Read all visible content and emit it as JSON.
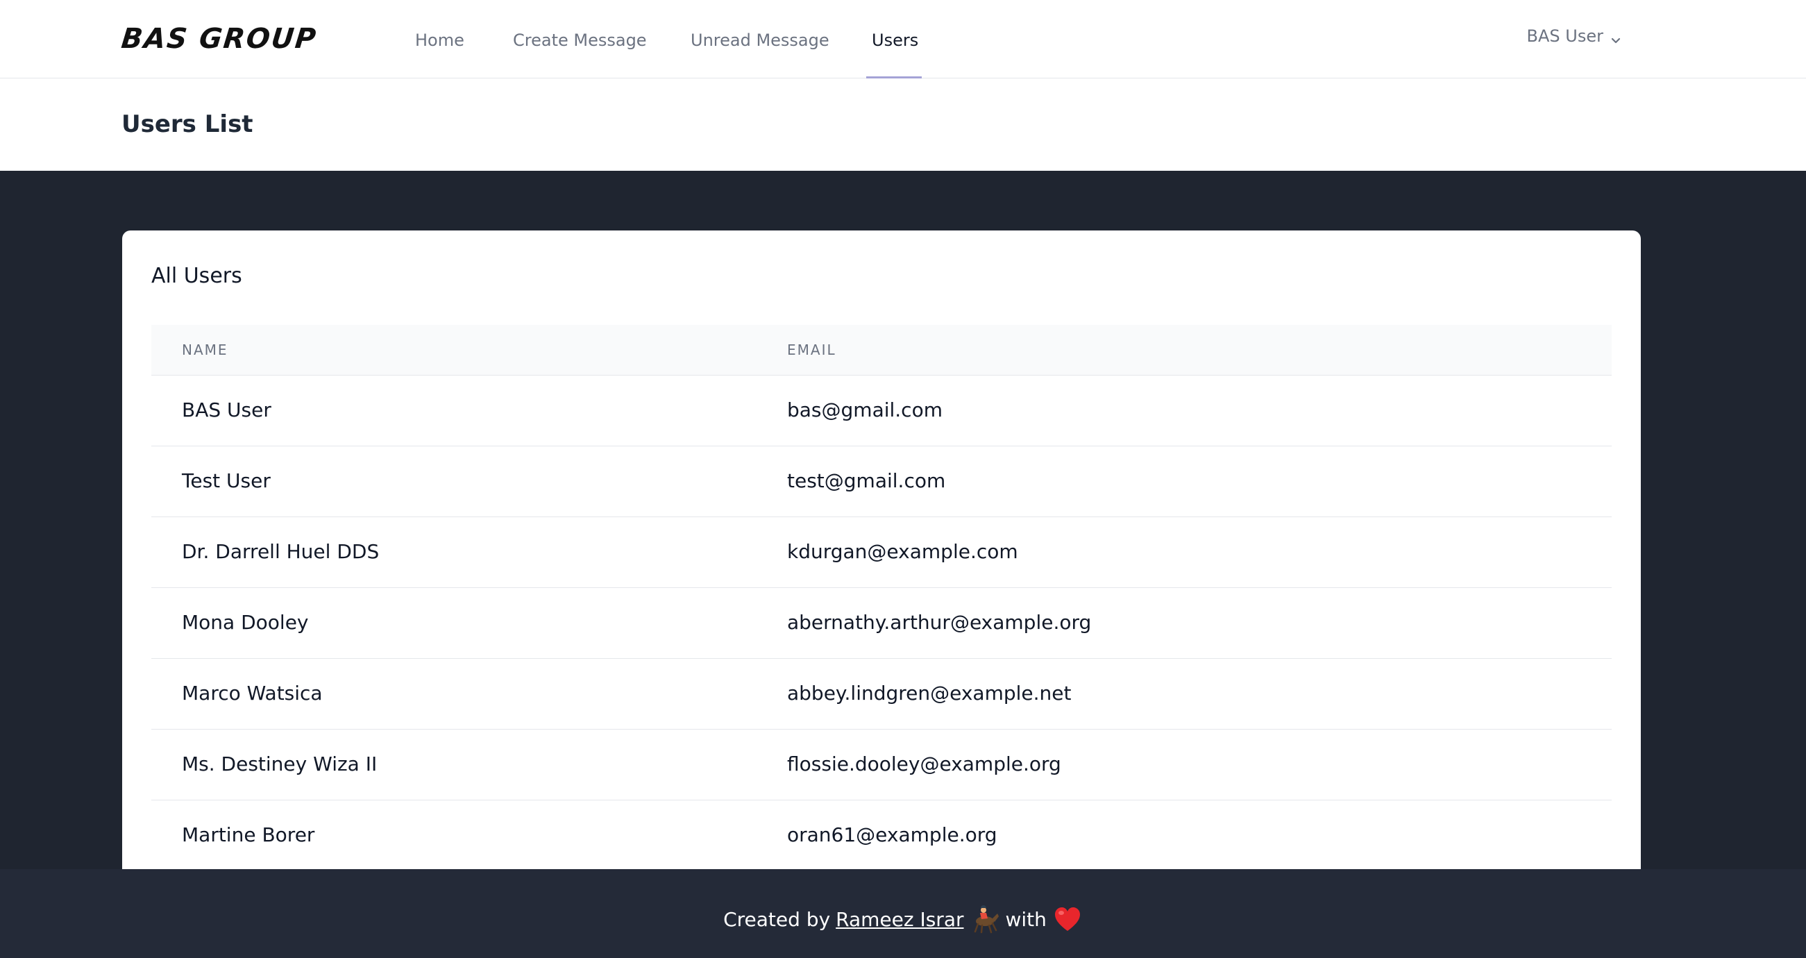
{
  "brand": {
    "logo_text": "BAS GROUP"
  },
  "nav": {
    "items": [
      {
        "label": "Home"
      },
      {
        "label": "Create Message"
      },
      {
        "label": "Unread Message"
      },
      {
        "label": "Users"
      }
    ],
    "active": "Users",
    "user_menu_label": "BAS User"
  },
  "header": {
    "title": "Users List"
  },
  "card": {
    "title": "All Users",
    "columns": [
      "Name",
      "Email"
    ],
    "rows": [
      {
        "name": "BAS User",
        "email": "bas@gmail.com"
      },
      {
        "name": "Test User",
        "email": "test@gmail.com"
      },
      {
        "name": "Dr. Darrell Huel DDS",
        "email": "kdurgan@example.com"
      },
      {
        "name": "Mona Dooley",
        "email": "abernathy.arthur@example.org"
      },
      {
        "name": "Marco Watsica",
        "email": "abbey.lindgren@example.net"
      },
      {
        "name": "Ms. Destiney Wiza II",
        "email": "flossie.dooley@example.org"
      },
      {
        "name": "Martine Borer",
        "email": "oran61@example.org"
      }
    ]
  },
  "footer": {
    "prefix": "Created by",
    "author": "Rameez Israr",
    "middle": "with",
    "icons": [
      "horse-racing-icon",
      "heart-icon"
    ]
  },
  "colors": {
    "page_bg": "#1f2530",
    "footer_bg": "#242a38",
    "accent_underline": "#a5a3d6",
    "heart": "#e8262c"
  }
}
